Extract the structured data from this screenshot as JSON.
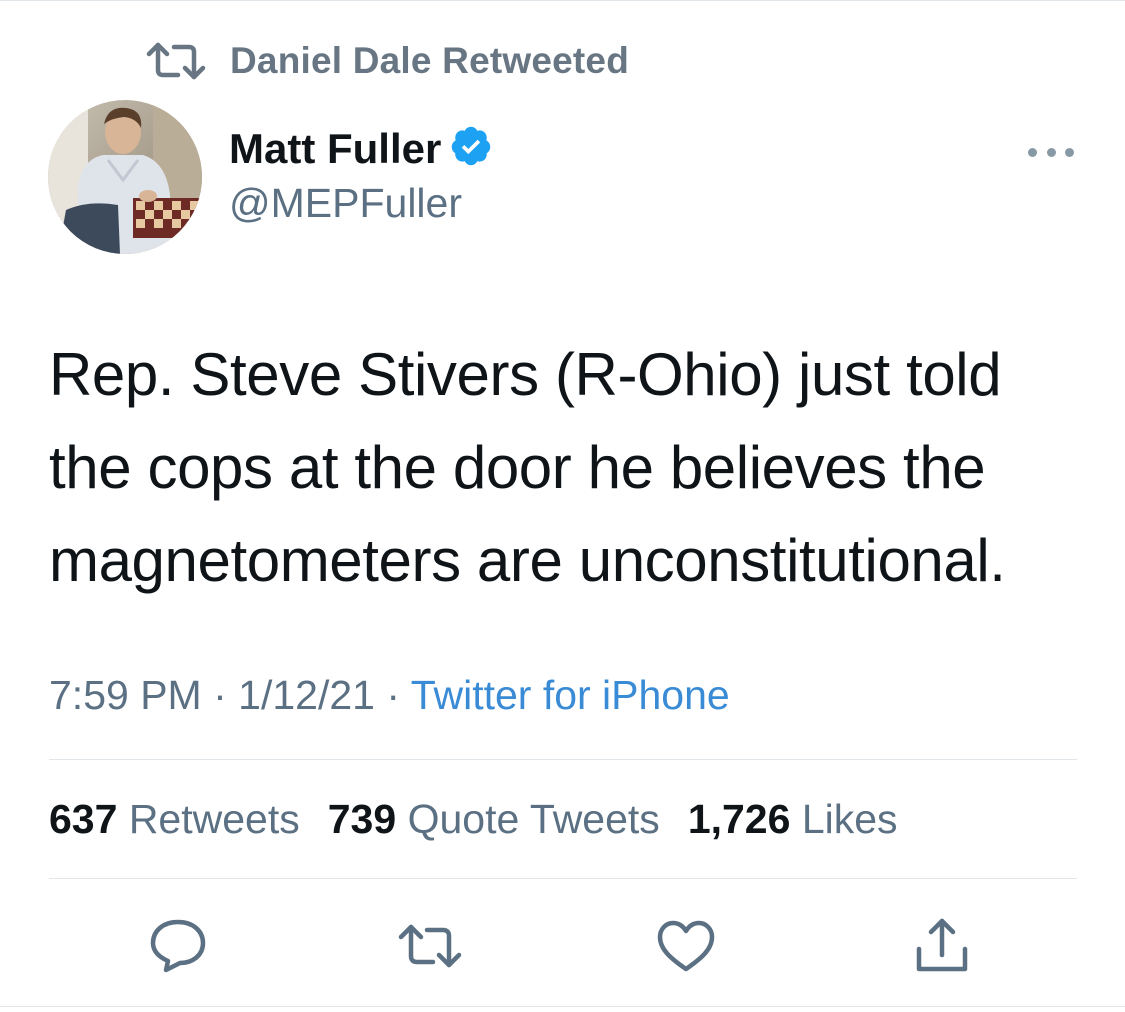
{
  "retweet_banner": {
    "text": "Daniel Dale Retweeted",
    "icon": "retweet-icon"
  },
  "author": {
    "name": "Matt Fuller",
    "handle": "@MEPFuller",
    "verified": true
  },
  "tweet": {
    "text": "Rep. Steve Stivers (R-Ohio) just told the cops at the door he believes the magnetometers are unconstitutional."
  },
  "meta": {
    "time": "7:59 PM",
    "separator": "·",
    "date": "1/12/21",
    "source": "Twitter for iPhone"
  },
  "stats": {
    "retweets_count": "637",
    "retweets_label": "Retweets",
    "quotes_count": "739",
    "quotes_label": "Quote Tweets",
    "likes_count": "1,726",
    "likes_label": "Likes"
  },
  "actions": [
    "reply-icon",
    "retweet-icon",
    "like-icon",
    "share-icon"
  ],
  "colors": {
    "text_primary": "#0f1419",
    "text_secondary": "#5b7083",
    "link": "#3a8bd6",
    "verified": "#1da1f2",
    "icon": "#5b7083",
    "divider": "#e1e6ea"
  }
}
